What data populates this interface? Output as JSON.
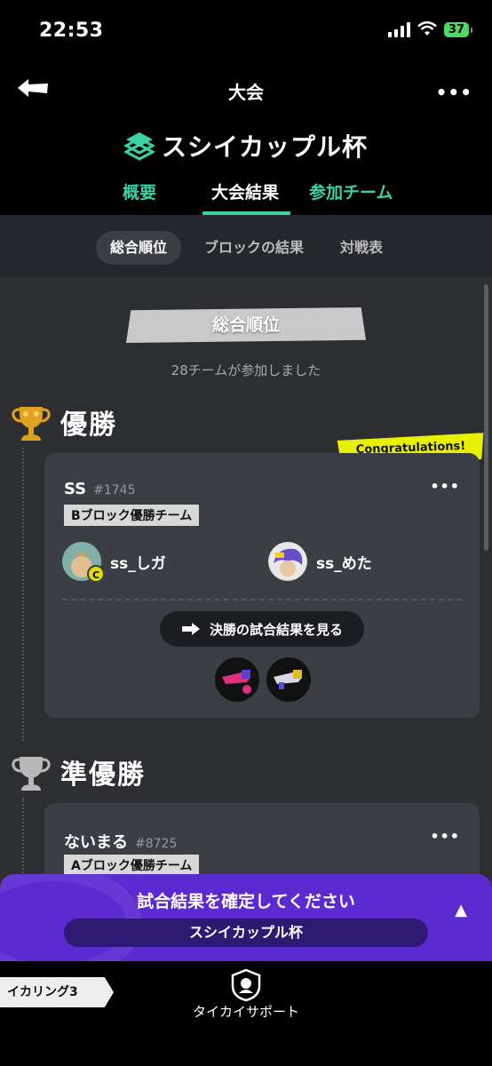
{
  "status": {
    "time": "22:53",
    "battery": "37"
  },
  "header": {
    "title": "大会",
    "tournament_name": "スシイカップル杯"
  },
  "tabs": [
    {
      "label": "概要"
    },
    {
      "label": "大会結果"
    },
    {
      "label": "参加チーム"
    }
  ],
  "subtabs": [
    {
      "label": "総合順位"
    },
    {
      "label": "ブロックの結果"
    },
    {
      "label": "対戦表"
    }
  ],
  "ranking": {
    "section_title": "総合順位",
    "team_count_text": "28チームが参加しました",
    "congrats": "Congratulations!",
    "winner": {
      "place_title": "優勝",
      "team_name": "SS",
      "team_id": "#1745",
      "block_badge": "Bブロック優勝チーム",
      "members": [
        {
          "name": "ss_しガ",
          "captain_mark": "C"
        },
        {
          "name": "ss_めた"
        }
      ],
      "results_button": "決勝の試合結果を見る"
    },
    "runner_up": {
      "place_title": "準優勝",
      "team_name": "ないまる",
      "team_id": "#8725",
      "block_badge": "Aブロック優勝チーム"
    }
  },
  "confirm_banner": {
    "text": "試合結果を確定してください",
    "tournament": "スシイカップル杯",
    "arrow": "▲"
  },
  "footer": {
    "brand": "イカリング3",
    "support_label": "タイカイサポート"
  },
  "colors": {
    "accent": "#3cd0a4",
    "banner": "#5b2bd1",
    "congrats": "#e6f000",
    "gold": "#e0a020",
    "silver": "#b8b8b8"
  }
}
